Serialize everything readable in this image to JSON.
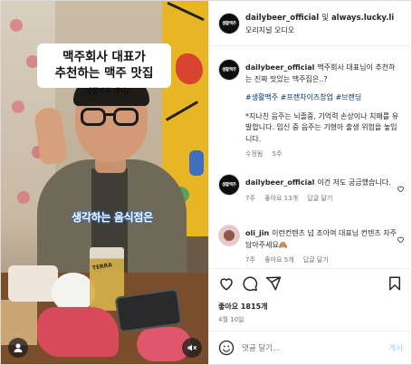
{
  "header": {
    "account_primary": "dailybeer_official",
    "connector": "및",
    "account_secondary": "always.lucky.li",
    "audio_label": "오리지널 오디오",
    "avatar_text": "생활맥주"
  },
  "media": {
    "overlay_title_line1": "맥주회사 대표가",
    "overlay_title_line2": "추천하는 맥주 맛집",
    "overlay_subtitle": "(생활맥주 제이)",
    "caption": "생각하는 음식점은",
    "beer_label": "TERRA"
  },
  "caption_entry": {
    "user": "dailybeer_official",
    "text": "맥주회사 대표님이 추천하는 진짜 맛있는 맥주집은..?",
    "hashtags": "#생활맥주 #프랜차이즈창업 #브랜딩",
    "warning": "*지나친 음주는 뇌졸중, 기억력 손상이나 치매를 유발합니다. 임신 중 음주는 기형아 출생 위험을 높입니다.",
    "meta_edited": "수정됨",
    "meta_time": "5주"
  },
  "comments": [
    {
      "user": "dailybeer_official",
      "text": "이건 저도 궁금했습니다.",
      "time": "7주",
      "likes": "좋아요 13개",
      "reply": "답글 달기"
    },
    {
      "user": "oli_jin",
      "text": "이런컨텐츠 넘 조아여 대표님 컨텐츠 자주 담아주세요🙈",
      "time": "7주",
      "likes": "좋아요 5개",
      "reply": "답글 달기"
    }
  ],
  "actions": {
    "likes_count": "좋아요 1815개",
    "date": "4월 10일"
  },
  "composer": {
    "placeholder": "댓글 달기...",
    "post_label": "게시"
  },
  "icons": {
    "like": "heart-icon",
    "comment": "comment-icon",
    "share": "share-icon",
    "save": "bookmark-icon",
    "emoji": "emoji-icon",
    "user": "user-icon",
    "sound": "mute-icon"
  },
  "colors": {
    "link": "#00376b",
    "post_button": "#b3dbff",
    "muted": "#737373"
  }
}
